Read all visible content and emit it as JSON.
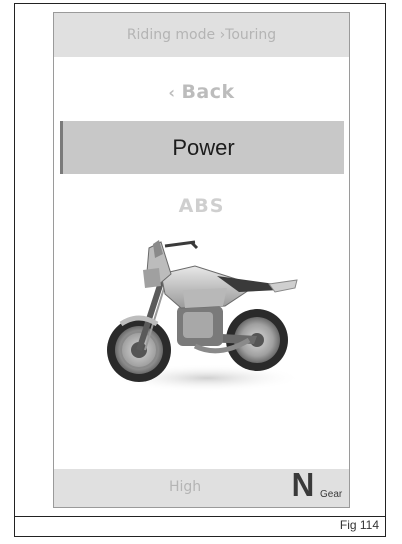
{
  "header": {
    "breadcrumb": "Riding mode ›Touring"
  },
  "menu": {
    "back_chevron": "‹",
    "back_label": "Back",
    "selected_label": "Power",
    "next_label": "ABS"
  },
  "footer": {
    "value": "High",
    "gear_value": "N",
    "gear_label": "Gear"
  },
  "figure": {
    "caption": "Fig 114"
  },
  "colors": {
    "header_bg": "#e0e0e0",
    "selected_bg": "#c8c8c8",
    "selected_bar": "#7a7a7a",
    "muted_text": "#b4b4b4"
  },
  "icons": {
    "back": "chevron-left-icon",
    "bike": "motorcycle-illustration"
  }
}
